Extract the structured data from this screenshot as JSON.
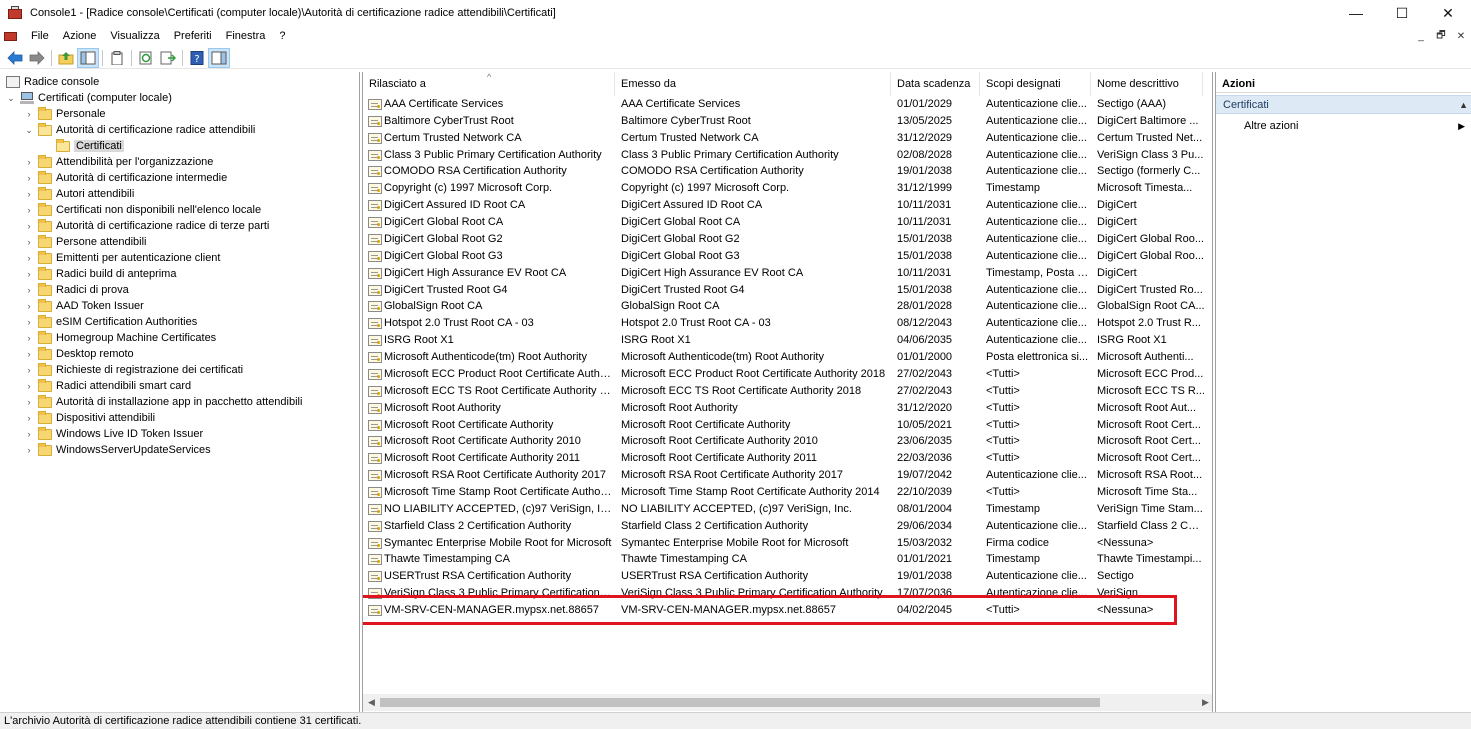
{
  "window": {
    "title": "Console1 - [Radice console\\Certificati (computer locale)\\Autorità di certificazione radice attendibili\\Certificati]",
    "minimize_glyph": "—",
    "maximize_glyph": "☐",
    "close_glyph": "✕"
  },
  "menu": {
    "items": [
      "File",
      "Azione",
      "Visualizza",
      "Preferiti",
      "Finestra",
      "?"
    ],
    "mdi_minimize": "_",
    "mdi_restore": "🗗",
    "mdi_close": "✕"
  },
  "toolbar": {
    "icons": [
      "back-arrow-icon",
      "forward-arrow-icon",
      "up-folder-icon",
      "show-hide-tree-icon",
      "clipboard-icon",
      "refresh-icon",
      "export-list-icon",
      "help-icon",
      "show-hide-action-pane-icon"
    ]
  },
  "tree": {
    "root": "Radice console",
    "computer": "Certificati (computer locale)",
    "items": [
      {
        "label": "Personale",
        "expanded": false
      },
      {
        "label": "Autorità di certificazione radice attendibili",
        "expanded": true
      },
      {
        "label": "Certificati",
        "child": true,
        "selected": true
      },
      {
        "label": "Attendibilità per l'organizzazione",
        "expanded": false
      },
      {
        "label": "Autorità di certificazione intermedie",
        "expanded": false
      },
      {
        "label": "Autori attendibili",
        "expanded": false
      },
      {
        "label": "Certificati non disponibili nell'elenco locale",
        "expanded": false
      },
      {
        "label": "Autorità di certificazione radice di terze parti",
        "expanded": false
      },
      {
        "label": "Persone attendibili",
        "expanded": false
      },
      {
        "label": "Emittenti per autenticazione client",
        "expanded": false
      },
      {
        "label": "Radici build di anteprima",
        "expanded": false
      },
      {
        "label": "Radici di prova",
        "expanded": false
      },
      {
        "label": "AAD Token Issuer",
        "expanded": false
      },
      {
        "label": "eSIM Certification Authorities",
        "expanded": false
      },
      {
        "label": "Homegroup Machine Certificates",
        "expanded": false
      },
      {
        "label": "Desktop remoto",
        "expanded": false
      },
      {
        "label": "Richieste di registrazione dei certificati",
        "expanded": false
      },
      {
        "label": "Radici attendibili smart card",
        "expanded": false
      },
      {
        "label": "Autorità di installazione app in pacchetto attendibili",
        "expanded": false
      },
      {
        "label": "Dispositivi attendibili",
        "expanded": false
      },
      {
        "label": "Windows Live ID Token Issuer",
        "expanded": false
      },
      {
        "label": "WindowsServerUpdateServices",
        "expanded": false
      }
    ]
  },
  "list": {
    "columns": [
      "Rilasciato a",
      "Emesso da",
      "Data scadenza",
      "Scopi designati",
      "Nome descrittivo"
    ],
    "sort_caret": "^",
    "rows": [
      [
        "AAA Certificate Services",
        "AAA Certificate Services",
        "01/01/2029",
        "Autenticazione clie...",
        "Sectigo (AAA)"
      ],
      [
        "Baltimore CyberTrust Root",
        "Baltimore CyberTrust Root",
        "13/05/2025",
        "Autenticazione clie...",
        "DigiCert Baltimore ..."
      ],
      [
        "Certum Trusted Network CA",
        "Certum Trusted Network CA",
        "31/12/2029",
        "Autenticazione clie...",
        "Certum Trusted Net..."
      ],
      [
        "Class 3 Public Primary Certification Authority",
        "Class 3 Public Primary Certification Authority",
        "02/08/2028",
        "Autenticazione clie...",
        "VeriSign Class 3 Pu..."
      ],
      [
        "COMODO RSA Certification Authority",
        "COMODO RSA Certification Authority",
        "19/01/2038",
        "Autenticazione clie...",
        "Sectigo (formerly C..."
      ],
      [
        "Copyright (c) 1997 Microsoft Corp.",
        "Copyright (c) 1997 Microsoft Corp.",
        "31/12/1999",
        "Timestamp",
        "Microsoft Timesta..."
      ],
      [
        "DigiCert Assured ID Root CA",
        "DigiCert Assured ID Root CA",
        "10/11/2031",
        "Autenticazione clie...",
        "DigiCert"
      ],
      [
        "DigiCert Global Root CA",
        "DigiCert Global Root CA",
        "10/11/2031",
        "Autenticazione clie...",
        "DigiCert"
      ],
      [
        "DigiCert Global Root G2",
        "DigiCert Global Root G2",
        "15/01/2038",
        "Autenticazione clie...",
        "DigiCert Global Roo..."
      ],
      [
        "DigiCert Global Root G3",
        "DigiCert Global Root G3",
        "15/01/2038",
        "Autenticazione clie...",
        "DigiCert Global Roo..."
      ],
      [
        "DigiCert High Assurance EV Root CA",
        "DigiCert High Assurance EV Root CA",
        "10/11/2031",
        "Timestamp, Posta e...",
        "DigiCert"
      ],
      [
        "DigiCert Trusted Root G4",
        "DigiCert Trusted Root G4",
        "15/01/2038",
        "Autenticazione clie...",
        "DigiCert Trusted Ro..."
      ],
      [
        "GlobalSign Root CA",
        "GlobalSign Root CA",
        "28/01/2028",
        "Autenticazione clie...",
        "GlobalSign Root CA..."
      ],
      [
        "Hotspot 2.0 Trust Root CA - 03",
        "Hotspot 2.0 Trust Root CA - 03",
        "08/12/2043",
        "Autenticazione clie...",
        "Hotspot 2.0 Trust R..."
      ],
      [
        "ISRG Root X1",
        "ISRG Root X1",
        "04/06/2035",
        "Autenticazione clie...",
        "ISRG Root X1"
      ],
      [
        "Microsoft Authenticode(tm) Root Authority",
        "Microsoft Authenticode(tm) Root Authority",
        "01/01/2000",
        "Posta elettronica si...",
        "Microsoft Authenti..."
      ],
      [
        "Microsoft ECC Product Root Certificate Authori...",
        "Microsoft ECC Product Root Certificate Authority 2018",
        "27/02/2043",
        "<Tutti>",
        "Microsoft ECC Prod..."
      ],
      [
        "Microsoft ECC TS Root Certificate Authority 2018",
        "Microsoft ECC TS Root Certificate Authority 2018",
        "27/02/2043",
        "<Tutti>",
        "Microsoft ECC TS R..."
      ],
      [
        "Microsoft Root Authority",
        "Microsoft Root Authority",
        "31/12/2020",
        "<Tutti>",
        "Microsoft Root Aut..."
      ],
      [
        "Microsoft Root Certificate Authority",
        "Microsoft Root Certificate Authority",
        "10/05/2021",
        "<Tutti>",
        "Microsoft Root Cert..."
      ],
      [
        "Microsoft Root Certificate Authority 2010",
        "Microsoft Root Certificate Authority 2010",
        "23/06/2035",
        "<Tutti>",
        "Microsoft Root Cert..."
      ],
      [
        "Microsoft Root Certificate Authority 2011",
        "Microsoft Root Certificate Authority 2011",
        "22/03/2036",
        "<Tutti>",
        "Microsoft Root Cert..."
      ],
      [
        "Microsoft RSA Root Certificate Authority 2017",
        "Microsoft RSA Root Certificate Authority 2017",
        "19/07/2042",
        "Autenticazione clie...",
        "Microsoft RSA Root..."
      ],
      [
        "Microsoft Time Stamp Root Certificate Authorit...",
        "Microsoft Time Stamp Root Certificate Authority 2014",
        "22/10/2039",
        "<Tutti>",
        "Microsoft Time Sta..."
      ],
      [
        "NO LIABILITY ACCEPTED, (c)97 VeriSign, Inc.",
        "NO LIABILITY ACCEPTED, (c)97 VeriSign, Inc.",
        "08/01/2004",
        "Timestamp",
        "VeriSign Time Stam..."
      ],
      [
        "Starfield Class 2 Certification Authority",
        "Starfield Class 2 Certification Authority",
        "29/06/2034",
        "Autenticazione clie...",
        "Starfield Class 2 Cer..."
      ],
      [
        "Symantec Enterprise Mobile Root for Microsoft",
        "Symantec Enterprise Mobile Root for Microsoft",
        "15/03/2032",
        "Firma codice",
        "<Nessuna>"
      ],
      [
        "Thawte Timestamping CA",
        "Thawte Timestamping CA",
        "01/01/2021",
        "Timestamp",
        "Thawte Timestampi..."
      ],
      [
        "USERTrust RSA Certification Authority",
        "USERTrust RSA Certification Authority",
        "19/01/2038",
        "Autenticazione clie...",
        "Sectigo"
      ],
      [
        "VeriSign Class 3 Public Primary Certification Au...",
        "VeriSign Class 3 Public Primary Certification Authority",
        "17/07/2036",
        "Autenticazione clie...",
        "VeriSign"
      ],
      [
        "VM-SRV-CEN-MANAGER.mypsx.net.88657",
        "VM-SRV-CEN-MANAGER.mypsx.net.88657",
        "04/02/2045",
        "<Tutti>",
        "<Nessuna>"
      ]
    ],
    "highlight_color": "#e0141e",
    "scroll_left_glyph": "◀",
    "scroll_right_glyph": "▶"
  },
  "actions": {
    "header": "Azioni",
    "section": "Certificati",
    "section_collapse_glyph": "▲",
    "item": "Altre azioni",
    "item_arrow_glyph": "▶"
  },
  "status": {
    "text": "L'archivio Autorità di certificazione radice attendibili contiene 31 certificati."
  }
}
